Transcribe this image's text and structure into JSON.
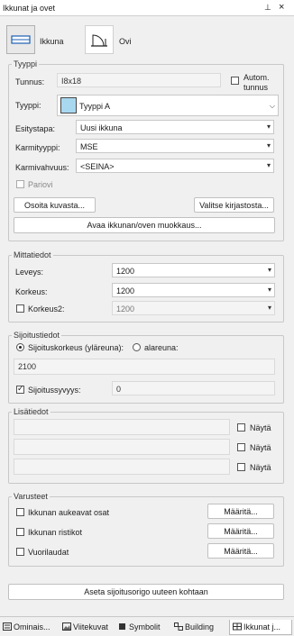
{
  "window": {
    "title": "Ikkunat ja ovet",
    "pin": "⊥",
    "close": "×"
  },
  "types": {
    "window_label": "Ikkuna",
    "door_label": "Ovi"
  },
  "tyyppi": {
    "legend": "Tyyppi",
    "tunnus_label": "Tunnus:",
    "tunnus_value": "I8x18",
    "autom_label1": "Autom.",
    "autom_label2": "tunnus",
    "tyyppi_label": "Tyyppi:",
    "tyyppi_value": "Tyyppi A",
    "esitystapa_label": "Esitystapa:",
    "esitystapa_value": "Uusi ikkuna",
    "karmityyppi_label": "Karmityyppi:",
    "karmityyppi_value": "MSE",
    "karmivahvuus_label": "Karmivahvuus:",
    "karmivahvuus_value": "<SEINA>",
    "pariovi_label": "Pariovi",
    "osoita_btn": "Osoita kuvasta...",
    "valitse_btn": "Valitse kirjastosta...",
    "avaa_btn": "Avaa ikkunan/oven muokkaus..."
  },
  "mittatiedot": {
    "legend": "Mittatiedot",
    "leveys_label": "Leveys:",
    "leveys_value": "1200",
    "korkeus_label": "Korkeus:",
    "korkeus_value": "1200",
    "korkeus2_label": "Korkeus2:",
    "korkeus2_value": "1200"
  },
  "sijoitustiedot": {
    "legend": "Sijoitustiedot",
    "ylareuna_label": "Sijoituskorkeus (yläreuna):",
    "alareuna_label": "alareuna:",
    "korkeus_value": "2100",
    "syvyys_label": "Sijoitussyvyys:",
    "syvyys_value": "0"
  },
  "lisatiedot": {
    "legend": "Lisätiedot",
    "nayta_label": "Näytä"
  },
  "varusteet": {
    "legend": "Varusteet",
    "items": [
      {
        "label": "Ikkunan aukeavat osat",
        "button": "Määritä..."
      },
      {
        "label": "Ikkunan ristikot",
        "button": "Määritä..."
      },
      {
        "label": "Vuorilaudat",
        "button": "Määritä..."
      }
    ]
  },
  "aseta_btn": "Aseta sijoitusorigo uuteen kohtaan",
  "tabs": [
    {
      "label": "Ominais...",
      "icon": "properties-icon"
    },
    {
      "label": "Viitekuvat",
      "icon": "reference-images-icon"
    },
    {
      "label": "Symbolit",
      "icon": "symbols-icon"
    },
    {
      "label": "Building",
      "icon": "building-icon"
    },
    {
      "label": "Ikkunat j...",
      "icon": "windows-doors-icon"
    }
  ],
  "colors": {
    "swatch": "#a8d8f0",
    "selected_type_bg": "#e4e4e4"
  }
}
